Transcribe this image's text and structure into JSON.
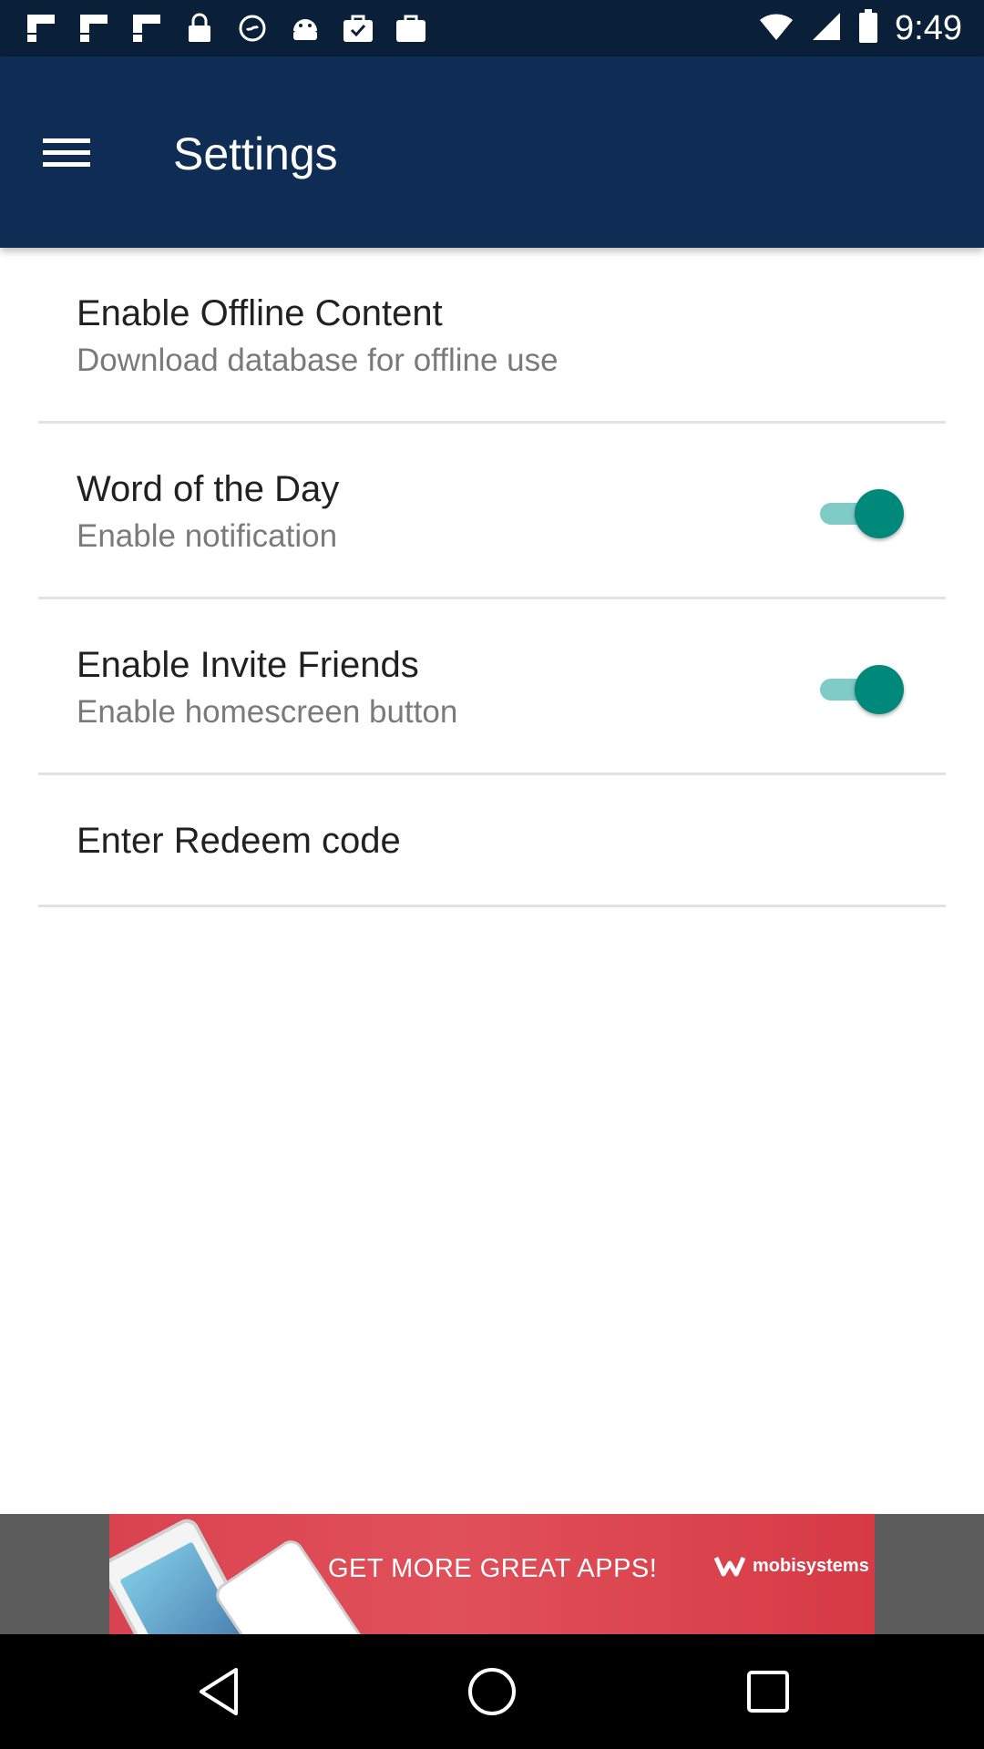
{
  "status_bar": {
    "time": "9:49",
    "icons": [
      "flipboard-icon",
      "flipboard-icon",
      "flipboard-icon",
      "lock-icon",
      "ring-icon",
      "android-icon",
      "briefcase-check-icon",
      "briefcase-icon"
    ],
    "right_icons": [
      "wifi-icon",
      "signal-icon",
      "battery-icon"
    ]
  },
  "app_bar": {
    "title": "Settings",
    "menu_icon": "hamburger-menu-icon",
    "background": "#0f2c55"
  },
  "settings": [
    {
      "title": "Enable Offline Content",
      "subtitle": "Download database for offline use"
    },
    {
      "title": "Word of the Day",
      "subtitle": "Enable notification",
      "toggle_on": true
    },
    {
      "title": "Enable Invite Friends",
      "subtitle": "Enable homescreen button",
      "toggle_on": true
    },
    {
      "title": "Enter Redeem code"
    }
  ],
  "ad": {
    "text": "GET MORE GREAT APPS!",
    "brand": "mobisystems"
  },
  "colors": {
    "accent": "#00897b",
    "accent_track": "#7fcbc6",
    "status_bar": "#0a1f38"
  },
  "nav_bar": {
    "icons": [
      "back-triangle-icon",
      "home-circle-icon",
      "recents-square-icon"
    ]
  }
}
